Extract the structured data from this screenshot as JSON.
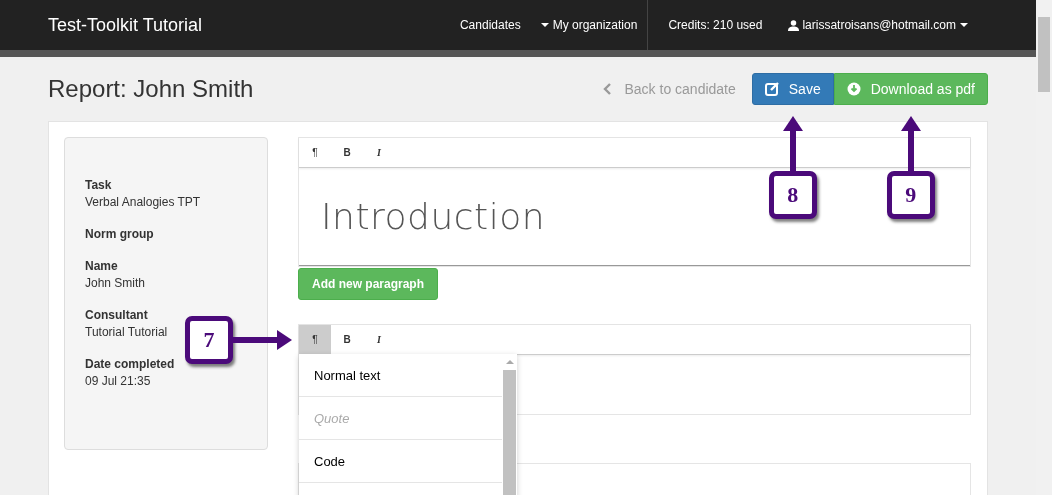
{
  "navbar": {
    "brand": "Test-Toolkit Tutorial",
    "links": [
      {
        "label": "Candidates",
        "caret": false
      },
      {
        "label": "My organization",
        "caret": true
      }
    ],
    "credits": "Credits: 210 used",
    "user": "larissatroisans@hotmail.com"
  },
  "header": {
    "title": "Report: John Smith",
    "back_link": "Back to candidate",
    "buttons": [
      {
        "kind": "save",
        "label": "Save",
        "callout": "8"
      },
      {
        "kind": "download",
        "label": "Download as pdf",
        "callout": "9"
      }
    ]
  },
  "info": [
    {
      "label": "Task",
      "value": "Verbal Analogies TPT"
    },
    {
      "label": "Norm group"
    },
    {
      "label": "Name",
      "value": "John Smith"
    },
    {
      "label": "Consultant",
      "value": "Tutorial Tutorial"
    },
    {
      "label": "Date completed",
      "value": "09 Jul 21:35"
    }
  ],
  "editors": [
    {
      "toolbar": [
        {
          "kind": "paragraph",
          "label": "¶",
          "selected": false
        },
        {
          "kind": "bold",
          "label": "B",
          "selected": false
        },
        {
          "kind": "italic",
          "label": "I",
          "selected": false
        }
      ],
      "heading": "Introduction",
      "add_button": "Add new paragraph"
    },
    {
      "toolbar": [
        {
          "kind": "paragraph",
          "label": "¶",
          "selected": true,
          "callout": "7"
        },
        {
          "kind": "bold",
          "label": "B",
          "selected": false
        },
        {
          "kind": "italic",
          "label": "I",
          "selected": false
        }
      ],
      "menu": [
        {
          "kind": "normal",
          "label": "Normal text"
        },
        {
          "kind": "quote",
          "label": "Quote"
        },
        {
          "kind": "code",
          "label": "Code"
        }
      ]
    }
  ]
}
